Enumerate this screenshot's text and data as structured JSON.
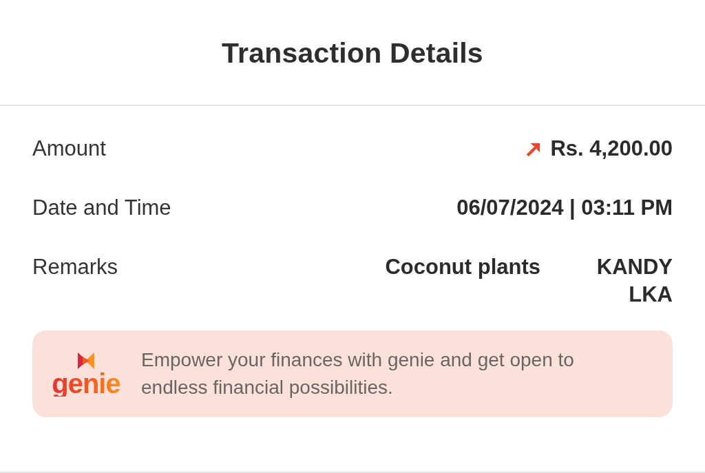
{
  "header": {
    "title": "Transaction Details"
  },
  "rows": [
    {
      "kind": "amount",
      "label": "Amount",
      "values": [
        "Rs. 4,200.00"
      ]
    },
    {
      "kind": "text",
      "label": "Date and Time",
      "values": [
        "06/07/2024 | 03:11 PM"
      ]
    },
    {
      "kind": "remarks",
      "label": "Remarks",
      "values": [
        "Coconut plants",
        "KANDY LKA"
      ]
    }
  ],
  "banner": {
    "logo_text": "genie",
    "message": "Empower your finances with genie and get open to endless financial possibilities."
  }
}
